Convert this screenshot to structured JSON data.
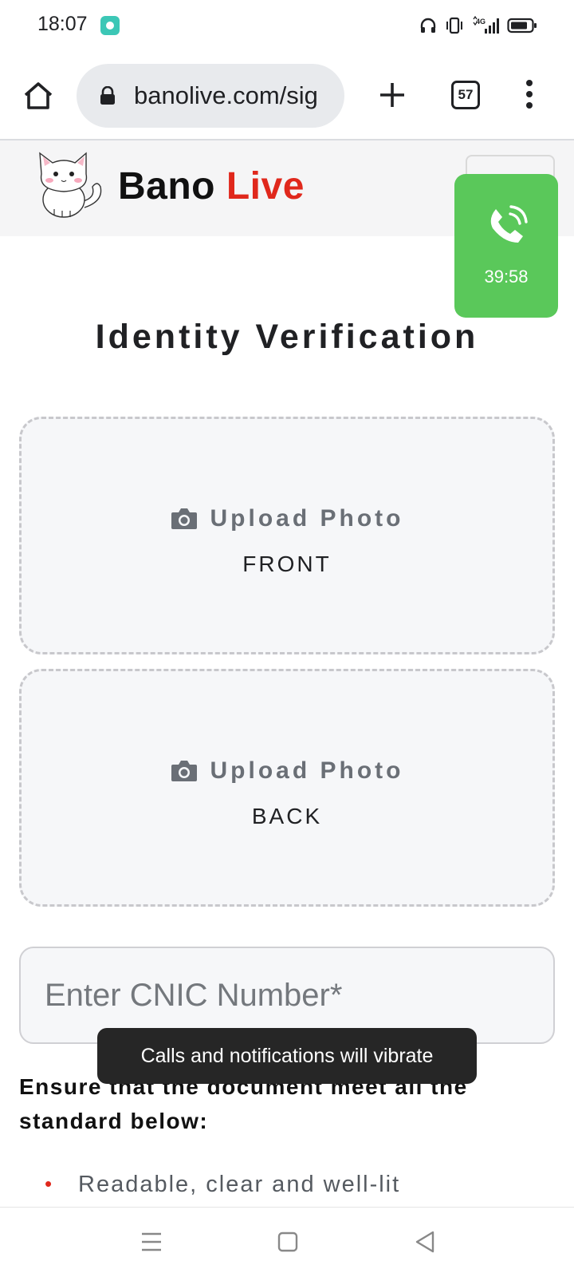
{
  "status_bar": {
    "time": "18:07",
    "icons": [
      "app-notification-icon",
      "headphones-icon",
      "vibrate-icon",
      "4g-signal-icon",
      "battery-icon"
    ]
  },
  "browser": {
    "url": "banolive.com/sig",
    "tab_count": "57",
    "icons": [
      "home-icon",
      "lock-icon",
      "plus-icon",
      "tabs-icon",
      "more-vert-icon"
    ]
  },
  "site_header": {
    "brand_part1": "Bano",
    "brand_part2": "Live",
    "brand_accent_color": "#e0281c"
  },
  "call_widget": {
    "timer": "39:58",
    "color": "#5ac85a"
  },
  "page": {
    "title": "Identity Verification",
    "upload_front": {
      "label": "Upload Photo",
      "side": "FRONT"
    },
    "upload_back": {
      "label": "Upload Photo",
      "side": "BACK"
    },
    "cnic_placeholder": "Enter CNIC Number*",
    "ensure_text": "Ensure that the document meet all the standard below:",
    "requirements": [
      "Readable, clear and well-lit"
    ]
  },
  "toast": {
    "message": "Calls and notifications will vibrate"
  }
}
